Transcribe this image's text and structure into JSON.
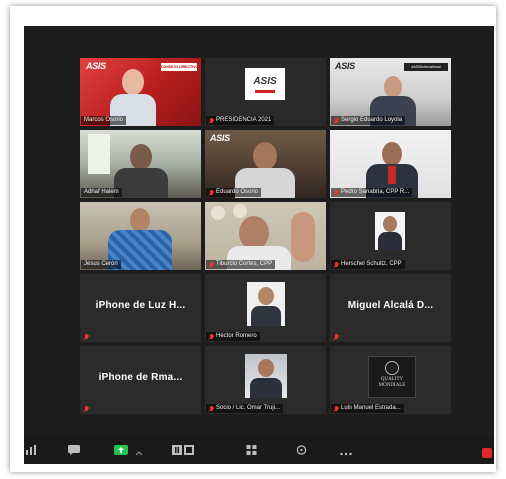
{
  "participants": [
    {
      "name": "Marcos Osorio",
      "muted": false
    },
    {
      "name": "PRESIDENCIA 2021",
      "muted": true
    },
    {
      "name": "Sergio Eduardo Loyola",
      "muted": true
    },
    {
      "name": "Adhaf Halem",
      "muted": false,
      "highlighted": true
    },
    {
      "name": "Eduardo Osorio",
      "muted": true
    },
    {
      "name": "Pedro Sanabria, CPP R...",
      "muted": true
    },
    {
      "name": "Jesus Cerón",
      "muted": false
    },
    {
      "name": "Tiburcio Cortes, CPP",
      "muted": true
    },
    {
      "name": "Herschel Schultz, CPP",
      "muted": true
    },
    {
      "name": "iPhone de Luz H...",
      "muted": true,
      "video_off": true
    },
    {
      "name": "Héctor Romero",
      "muted": true
    },
    {
      "name": "Miguel Alcalá D...",
      "muted": true,
      "video_off": true
    },
    {
      "name": "iPhone de Rma...",
      "muted": true,
      "video_off": true
    },
    {
      "name": "Socio / Lic. Omar Truji...",
      "muted": true
    },
    {
      "name": "Luis Manuel Estrada...",
      "muted": true
    }
  ],
  "brand_text": "ASIS",
  "banner_text_1": "CONSEJO DIRECTIVO 2021",
  "banner_text_2": "#ASISInternational",
  "logo_text": "QUALITY MONDIALE",
  "colors": {
    "accent": "#d9e36a",
    "muted": "#e33333",
    "background": "#1d1d1d"
  },
  "toolbar": [
    "chart-icon",
    "chat-icon",
    "share-screen-icon",
    "chevron-up-icon",
    "record-icon",
    "apps-icon",
    "reactions-icon",
    "more-icon"
  ]
}
